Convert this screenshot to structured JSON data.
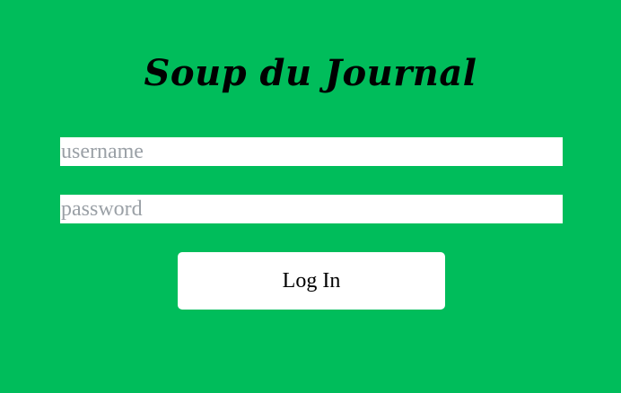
{
  "app": {
    "title": "Soup du Journal"
  },
  "login_form": {
    "username": {
      "value": "",
      "placeholder": "username"
    },
    "password": {
      "value": "",
      "placeholder": "password"
    },
    "login_button_label": "Log In"
  },
  "colors": {
    "background": "#00bd5b",
    "field_background": "#ffffff",
    "placeholder": "#9aa0a6",
    "button_background": "#ffffff",
    "text": "#000000"
  }
}
